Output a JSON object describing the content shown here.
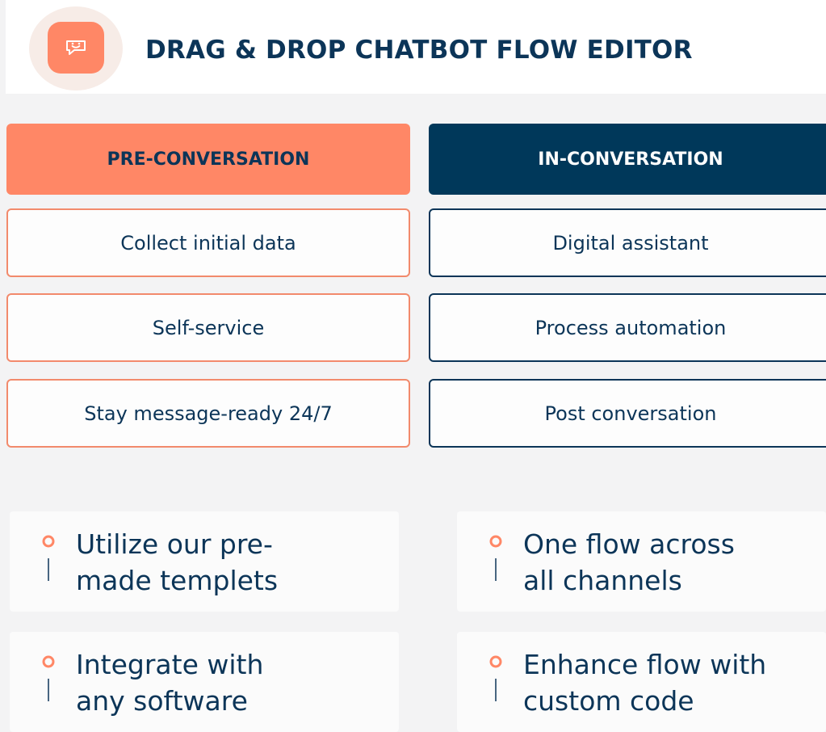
{
  "header": {
    "title": "DRAG & DROP CHATBOT FLOW EDITOR",
    "logo_icon": "chat-bubble-smile-icon"
  },
  "columns": [
    {
      "heading": "PRE-CONVERSATION",
      "items": [
        "Collect initial data",
        "Self-service",
        "Stay message-ready 24/7"
      ]
    },
    {
      "heading": "IN-CONVERSATION",
      "items": [
        "Digital assistant",
        "Process automation",
        "Post conversation"
      ]
    }
  ],
  "features": [
    {
      "line1": "Utilize our pre-",
      "line2": "made templets"
    },
    {
      "line1": "One flow across",
      "line2": "all channels"
    },
    {
      "line1": "Integrate with",
      "line2": "any software"
    },
    {
      "line1": "Enhance flow with",
      "line2": "custom code"
    }
  ],
  "colors": {
    "accent": "#ff8766",
    "navy": "#00385a",
    "text": "#0c3558",
    "background": "#f3f3f4"
  }
}
